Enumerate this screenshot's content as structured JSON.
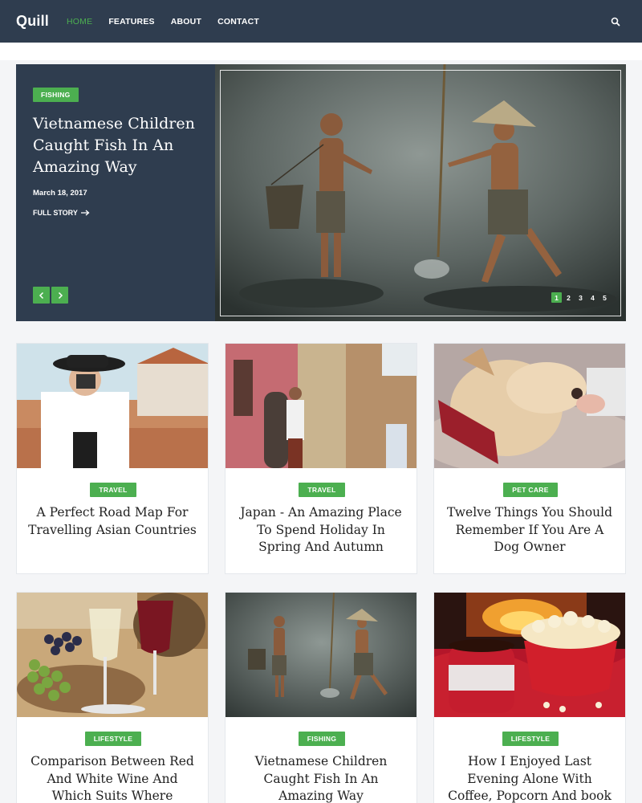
{
  "brand": {
    "name": "Quill",
    "accent": "#4caf50",
    "nav_bg": "#2f3d4f"
  },
  "nav": {
    "items": [
      "HOME",
      "FEATURES",
      "ABOUT",
      "CONTACT"
    ],
    "active": "HOME",
    "search_icon": "search-icon"
  },
  "hero": {
    "category": "FISHING",
    "title": "Vietnamese Children Caught Fish In An Amazing Way",
    "date": "March 18, 2017",
    "more": "FULL STORY",
    "more_icon": "arrow-right-icon",
    "prev_icon": "chevron-left-icon",
    "next_icon": "chevron-right-icon",
    "pages": [
      "1",
      "2",
      "3",
      "4",
      "5"
    ],
    "active_page": "1"
  },
  "posts": [
    {
      "category": "TRAVEL",
      "title": "A Perfect Road Map For Travelling Asian Countries"
    },
    {
      "category": "TRAVEL",
      "title": "Japan - An Amazing Place To Spend Holiday In Spring And Autumn"
    },
    {
      "category": "PET CARE",
      "title": "Twelve Things You Should Remember If You Are A Dog Owner"
    },
    {
      "category": "LIFESTYLE",
      "title": "Comparison Between Red And White Wine And Which Suits Where"
    },
    {
      "category": "FISHING",
      "title": "Vietnamese Children Caught Fish In An Amazing Way"
    },
    {
      "category": "LIFESTYLE",
      "title": "How I Enjoyed Last Evening Alone With Coffee, Popcorn And book"
    }
  ]
}
